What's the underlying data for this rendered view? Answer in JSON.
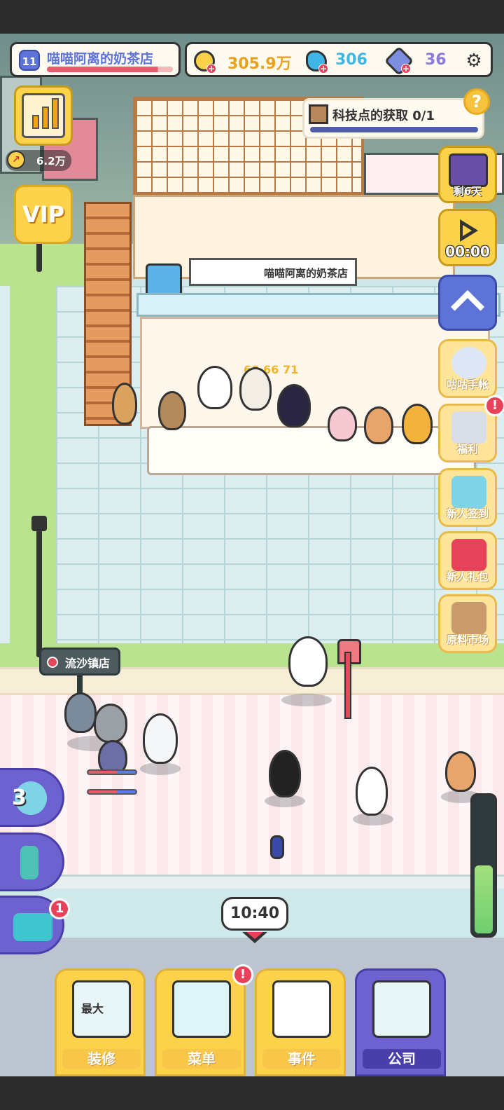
{
  "hud": {
    "level": "11",
    "shop_name": "喵喵阿离的奶茶店",
    "coins": "305.9万",
    "notes": "306",
    "gems": "36",
    "income": "6.2万",
    "vip": "VIP",
    "quest": "科技点的获取 0/1",
    "help": "?"
  },
  "side_buttons": {
    "days_left": "剩6天",
    "video_timer": "00:00",
    "ledger": "咕咕手帐",
    "welfare": "福利",
    "signin": "新人签到",
    "gift": "新人礼包",
    "market": "原料市场"
  },
  "left_tools": {
    "search_count": "3",
    "register_badge": "1"
  },
  "scene": {
    "shop_sign": "喵喵阿离的奶茶店",
    "cup_labels": [
      "66",
      "66",
      "71"
    ],
    "street_sign": "流沙镇店",
    "clock": "10:40",
    "power_level": 0.5
  },
  "bottom_nav": [
    {
      "label": "装修",
      "badge": "最大"
    },
    {
      "label": "菜单"
    },
    {
      "label": "事件"
    },
    {
      "label": "公司"
    }
  ],
  "colors": {
    "accent": "#5d73d8",
    "gold": "#fbd24a",
    "alert": "#e6435a",
    "coin_text": "#e8a21c",
    "note_text": "#3fb6e6",
    "gem_text": "#8c7ad8"
  },
  "icons": [
    "coin-icon",
    "music-note-icon",
    "gem-icon",
    "gear-icon",
    "bar-chart-icon",
    "play-icon",
    "chevron-up-icon",
    "magnifier-icon",
    "cup-icon",
    "cash-register-icon"
  ]
}
